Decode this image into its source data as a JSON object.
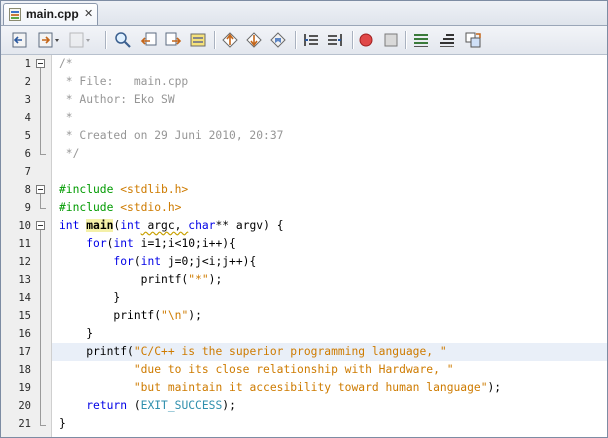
{
  "tab": {
    "label": "main.cpp",
    "close": "✕"
  },
  "toolbar": {
    "buttons": [
      "back-button",
      "forward-dropdown-button",
      "last-edit-button",
      "find-selection-button",
      "find-previous-button",
      "find-next-button",
      "toggle-highlight-button",
      "shift-left-button",
      "shift-right-button",
      "toggle-bookmark-button",
      "previous-bookmark-button",
      "next-bookmark-button",
      "start-macro-button",
      "stop-macro-button",
      "comment-button",
      "uncomment-button",
      "format-button"
    ]
  },
  "editor": {
    "line_numbers": [
      "1",
      "2",
      "3",
      "4",
      "5",
      "6",
      "7",
      "8",
      "9",
      "10",
      "11",
      "12",
      "13",
      "14",
      "15",
      "16",
      "17",
      "18",
      "19",
      "20",
      "21"
    ],
    "lines": {
      "l1": "/*",
      "l2": " * File:   main.cpp",
      "l3": " * Author: Eko SW",
      "l4": " *",
      "l5": " * Created on 29 Juni 2010, 20:37",
      "l6": " */",
      "l8a": "#include",
      "l8b": " <stdlib.h>",
      "l9a": "#include",
      "l9b": " <stdio.h>",
      "l10_kw": "int",
      "l10_sp": " ",
      "l10_fn": "main",
      "l10_p1": "(",
      "l10_kw2": "int",
      "l10_p2": " argc, ",
      "l10_kw3": "char",
      "l10_p3": "** argv) {",
      "l11_indent": "    ",
      "l11_kw": "for",
      "l11_p1": "(",
      "l11_kw2": "int",
      "l11_p2": " i=1;i<10;i++){",
      "l12_indent": "        ",
      "l12_kw": "for",
      "l12_p1": "(",
      "l12_kw2": "int",
      "l12_p2": " j=0;j<i;j++){",
      "l13_pre": "            printf(",
      "l13_str": "\"*\"",
      "l13_post": ");",
      "l14": "        }",
      "l15_pre": "        printf(",
      "l15_q1": "\"",
      "l15_esc": "\\n",
      "l15_q2": "\"",
      "l15_post": ");",
      "l16": "    }",
      "l17_pre": "    printf(",
      "l17_str": "\"C/C++ is the superior programming language, \"",
      "l18_pre": "           ",
      "l18_str": "\"due to its close relationship with Hardware, \"",
      "l19_pre": "           ",
      "l19_str": "\"but maintain it accesibility toward human language\"",
      "l19_post": ");",
      "l20_indent": "    ",
      "l20_kw": "return",
      "l20_p1": " (",
      "l20_mac": "EXIT_SUCCESS",
      "l20_p2": ");",
      "l21": "}"
    }
  },
  "colors": {
    "comment": "#969696",
    "keyword": "#0000e6",
    "preprocessor": "#009b00",
    "string": "#ce7b00",
    "macro": "#2f8fad",
    "current_line": "#e9eff8"
  }
}
